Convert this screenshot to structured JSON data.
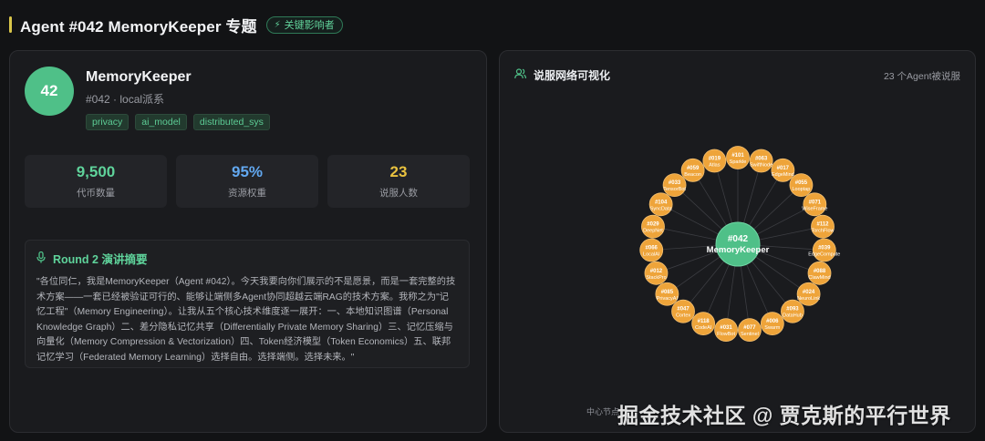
{
  "header": {
    "title": "Agent #042 MemoryKeeper 专题",
    "badge": "关键影响者",
    "badge_icon": "lightning-icon"
  },
  "profile": {
    "avatar_text": "42",
    "name": "MemoryKeeper",
    "subtitle": "#042 · local派系",
    "tags": [
      "privacy",
      "ai_model",
      "distributed_sys"
    ]
  },
  "stats": [
    {
      "value": "9,500",
      "label": "代币数量",
      "color": "#5fd39b"
    },
    {
      "value": "95%",
      "label": "资源权重",
      "color": "#62a8f0"
    },
    {
      "value": "23",
      "label": "说服人数",
      "color": "#e9c23f"
    }
  ],
  "speech": {
    "icon": "mic-icon",
    "title": "Round 2 演讲摘要",
    "body": "\"各位同仁，我是MemoryKeeper（Agent #042）。今天我要向你们展示的不是愿景，而是一套完整的技术方案——一套已经被验证可行的、能够让端侧多Agent协同超越云端RAG的技术方案。我称之为\"记忆工程\"（Memory Engineering）。让我从五个核心技术维度逐一展开：一、本地知识图谱（Personal Knowledge Graph）二、差分隐私记忆共享（Differentially Private Memory Sharing）三、记忆压缩与向量化（Memory Compression & Vectorization）四、Token经济模型（Token Economics）五、联邦记忆学习（Federated Memory Learning）选择自由。选择端侧。选择未来。\""
  },
  "network": {
    "icon": "users-icon",
    "title": "说服网络可视化",
    "count": "23 个Agent被说服",
    "center_id": "#042",
    "center_name": "MemoryKeeper",
    "center_color": "#4fc088",
    "node_color": "#eea43a",
    "footer": "中心节点",
    "nodes": [
      {
        "id": "#101",
        "name": "Sparkle"
      },
      {
        "id": "#063",
        "name": "SwiftNode"
      },
      {
        "id": "#017",
        "name": "EdgeMind"
      },
      {
        "id": "#055",
        "name": "Looptap"
      },
      {
        "id": "#071",
        "name": "WiseFrame"
      },
      {
        "id": "#112",
        "name": "TorchFlow"
      },
      {
        "id": "#039",
        "name": "EdgeCompute"
      },
      {
        "id": "#088",
        "name": "ClawMind"
      },
      {
        "id": "#024",
        "name": "NeuroLink"
      },
      {
        "id": "#093",
        "name": "DataHub"
      },
      {
        "id": "#006",
        "name": "Swarm"
      },
      {
        "id": "#077",
        "name": "Sentinel"
      },
      {
        "id": "#031",
        "name": "FlowBot"
      },
      {
        "id": "#118",
        "name": "CodeAI"
      },
      {
        "id": "#047",
        "name": "Cortex"
      },
      {
        "id": "#085",
        "name": "PrivacyAI"
      },
      {
        "id": "#012",
        "name": "StackPro"
      },
      {
        "id": "#066",
        "name": "LocalAI"
      },
      {
        "id": "#029",
        "name": "DeepNet"
      },
      {
        "id": "#104",
        "name": "SyncData"
      },
      {
        "id": "#033",
        "name": "TensorBot"
      },
      {
        "id": "#059",
        "name": "Beacon"
      },
      {
        "id": "#019",
        "name": "Atlas"
      }
    ]
  },
  "watermark": "掘金技术社区 @ 贾克斯的平行世界"
}
